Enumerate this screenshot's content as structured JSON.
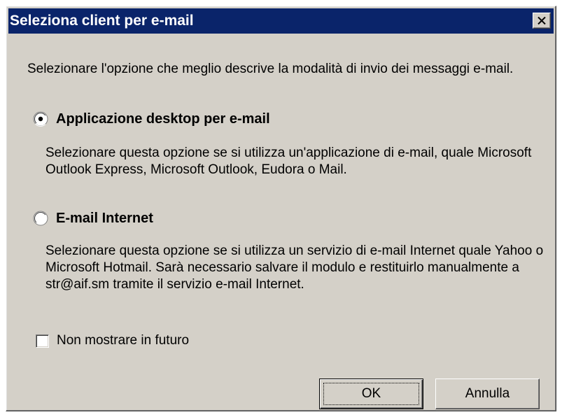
{
  "dialog": {
    "title": "Seleziona client per e-mail",
    "title_bar_color": "#0a246a",
    "intro_text": "Selezionare l'opzione che meglio descrive la modalità di invio dei messaggi e-mail.",
    "options": [
      {
        "label": "Applicazione desktop per e-mail",
        "selected": true,
        "description": "Selezionare questa opzione se si utilizza un'applicazione di e-mail, quale Microsoft Outlook Express, Microsoft Outlook, Eudora o Mail."
      },
      {
        "label": "E-mail Internet",
        "selected": false,
        "description": "Selezionare questa opzione se si utilizza un servizio di e-mail Internet quale Yahoo o Microsoft Hotmail. Sarà necessario salvare il modulo e restituirlo manualmente a str@aif.sm tramite il servizio e-mail Internet."
      }
    ],
    "dont_show_again": {
      "label": "Non mostrare in futuro",
      "checked": false
    },
    "buttons": {
      "ok": "OK",
      "cancel": "Annulla"
    },
    "icons": {
      "close": "close-icon",
      "radio_selected": "radio-selected-icon",
      "radio_unselected": "radio-unselected-icon"
    }
  }
}
